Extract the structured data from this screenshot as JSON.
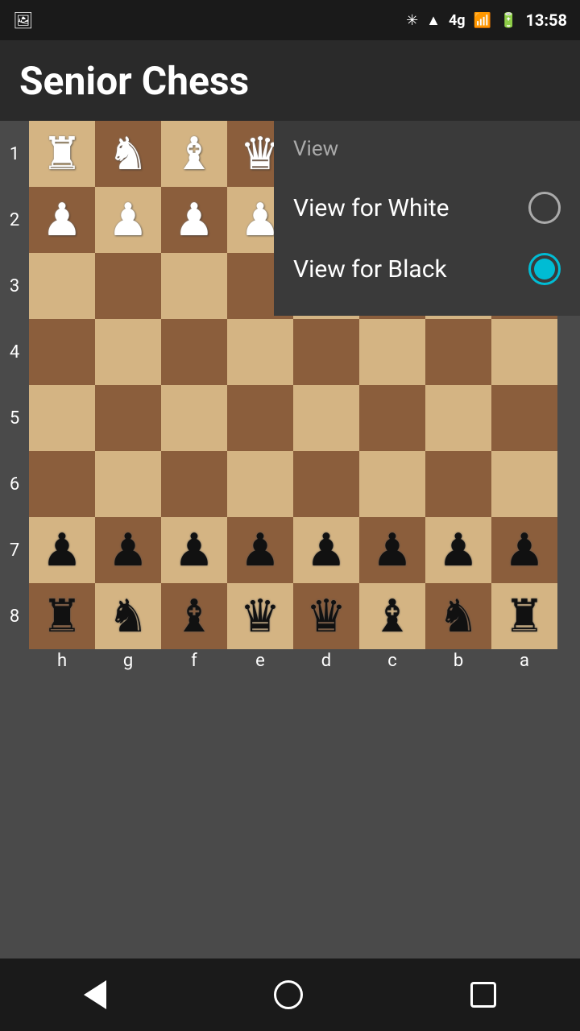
{
  "statusBar": {
    "time": "13:58",
    "icons": [
      "bluetooth",
      "wifi",
      "4g",
      "signal",
      "battery"
    ]
  },
  "appBar": {
    "title": "Senior Chess"
  },
  "dropdown": {
    "title": "View",
    "items": [
      {
        "label": "View for White",
        "selected": false
      },
      {
        "label": "View for Black",
        "selected": true
      }
    ]
  },
  "board": {
    "rowLabels": [
      "1",
      "2",
      "3",
      "4",
      "5",
      "6",
      "7",
      "8"
    ],
    "colLabels": [
      "h",
      "g",
      "f",
      "e",
      "d",
      "c",
      "b",
      "a"
    ],
    "cells": [
      {
        "piece": "♜",
        "color": "white"
      },
      {
        "piece": "♞",
        "color": "white"
      },
      {
        "piece": "♝",
        "color": "white"
      },
      {
        "piece": "♛",
        "color": "white"
      },
      {
        "piece": "",
        "color": ""
      },
      {
        "piece": "",
        "color": ""
      },
      {
        "piece": "",
        "color": ""
      },
      {
        "piece": "",
        "color": ""
      },
      {
        "piece": "♟",
        "color": "white"
      },
      {
        "piece": "♟",
        "color": "white"
      },
      {
        "piece": "♟",
        "color": "white"
      },
      {
        "piece": "♟",
        "color": "white"
      },
      {
        "piece": "",
        "color": ""
      },
      {
        "piece": "",
        "color": ""
      },
      {
        "piece": "",
        "color": ""
      },
      {
        "piece": "",
        "color": ""
      },
      {
        "piece": "",
        "color": ""
      },
      {
        "piece": "",
        "color": ""
      },
      {
        "piece": "",
        "color": ""
      },
      {
        "piece": "",
        "color": ""
      },
      {
        "piece": "",
        "color": ""
      },
      {
        "piece": "",
        "color": ""
      },
      {
        "piece": "",
        "color": ""
      },
      {
        "piece": "",
        "color": ""
      },
      {
        "piece": "",
        "color": ""
      },
      {
        "piece": "",
        "color": ""
      },
      {
        "piece": "",
        "color": ""
      },
      {
        "piece": "",
        "color": ""
      },
      {
        "piece": "",
        "color": ""
      },
      {
        "piece": "",
        "color": ""
      },
      {
        "piece": "",
        "color": ""
      },
      {
        "piece": "",
        "color": ""
      },
      {
        "piece": "",
        "color": ""
      },
      {
        "piece": "",
        "color": ""
      },
      {
        "piece": "",
        "color": ""
      },
      {
        "piece": "",
        "color": ""
      },
      {
        "piece": "",
        "color": ""
      },
      {
        "piece": "",
        "color": ""
      },
      {
        "piece": "",
        "color": ""
      },
      {
        "piece": "",
        "color": ""
      },
      {
        "piece": "",
        "color": ""
      },
      {
        "piece": "",
        "color": ""
      },
      {
        "piece": "",
        "color": ""
      },
      {
        "piece": "",
        "color": ""
      },
      {
        "piece": "",
        "color": ""
      },
      {
        "piece": "",
        "color": ""
      },
      {
        "piece": "",
        "color": ""
      },
      {
        "piece": "",
        "color": ""
      },
      {
        "piece": "♟",
        "color": "black"
      },
      {
        "piece": "♟",
        "color": "black"
      },
      {
        "piece": "♟",
        "color": "black"
      },
      {
        "piece": "♟",
        "color": "black"
      },
      {
        "piece": "♟",
        "color": "black"
      },
      {
        "piece": "♟",
        "color": "black"
      },
      {
        "piece": "♟",
        "color": "black"
      },
      {
        "piece": "♟",
        "color": "black"
      },
      {
        "piece": "♜",
        "color": "black"
      },
      {
        "piece": "♞",
        "color": "black"
      },
      {
        "piece": "♝",
        "color": "black"
      },
      {
        "piece": "♛",
        "color": "black"
      },
      {
        "piece": "♛",
        "color": "black"
      },
      {
        "piece": "♝",
        "color": "black"
      },
      {
        "piece": "♞",
        "color": "black"
      },
      {
        "piece": "♜",
        "color": "black"
      }
    ]
  },
  "navBar": {
    "backLabel": "back",
    "homeLabel": "home",
    "recentsLabel": "recents"
  }
}
